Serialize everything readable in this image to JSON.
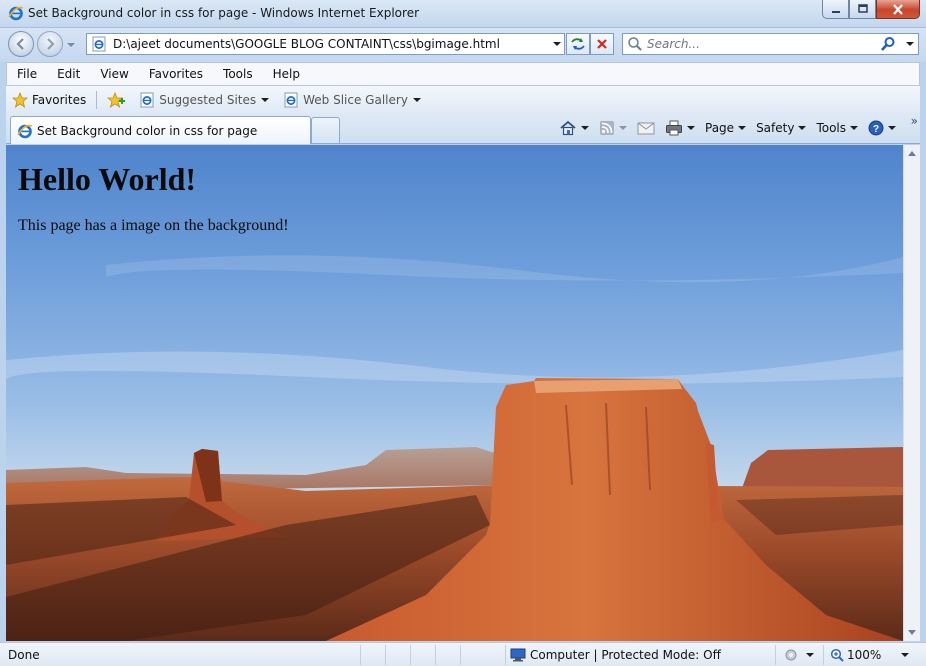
{
  "window": {
    "title": "Set Background color in css for page - Windows Internet Explorer"
  },
  "address_bar": {
    "url": "D:\\ajeet documents\\GOOGLE BLOG CONTAINT\\css\\bgimage.html"
  },
  "search": {
    "placeholder": "Search..."
  },
  "menu": {
    "items": [
      "File",
      "Edit",
      "View",
      "Favorites",
      "Tools",
      "Help"
    ]
  },
  "favorites_bar": {
    "favorites_label": "Favorites",
    "links": [
      {
        "label": "Suggested Sites",
        "icon": "ie-page-icon"
      },
      {
        "label": "Web Slice Gallery",
        "icon": "ie-page-icon"
      }
    ]
  },
  "tabs": [
    {
      "title": "Set Background color in css for page",
      "active": true
    }
  ],
  "command_bar": {
    "items": [
      "Page",
      "Safety",
      "Tools"
    ],
    "icons": [
      "home-icon",
      "feeds-icon",
      "read-mail-icon",
      "print-icon",
      "help-icon"
    ]
  },
  "page": {
    "heading": "Hello World!",
    "paragraph": "This page has a image on the background!",
    "background_image": "desert mesa landscape (Monument Valley)"
  },
  "status_bar": {
    "text": "Done",
    "zone": "Computer | Protected Mode: Off",
    "zoom": "100%"
  },
  "colors": {
    "chrome": "#c5d8ef",
    "close_button": "#c8452c",
    "rock": "#b9472a",
    "sky": "#6e9edb"
  }
}
